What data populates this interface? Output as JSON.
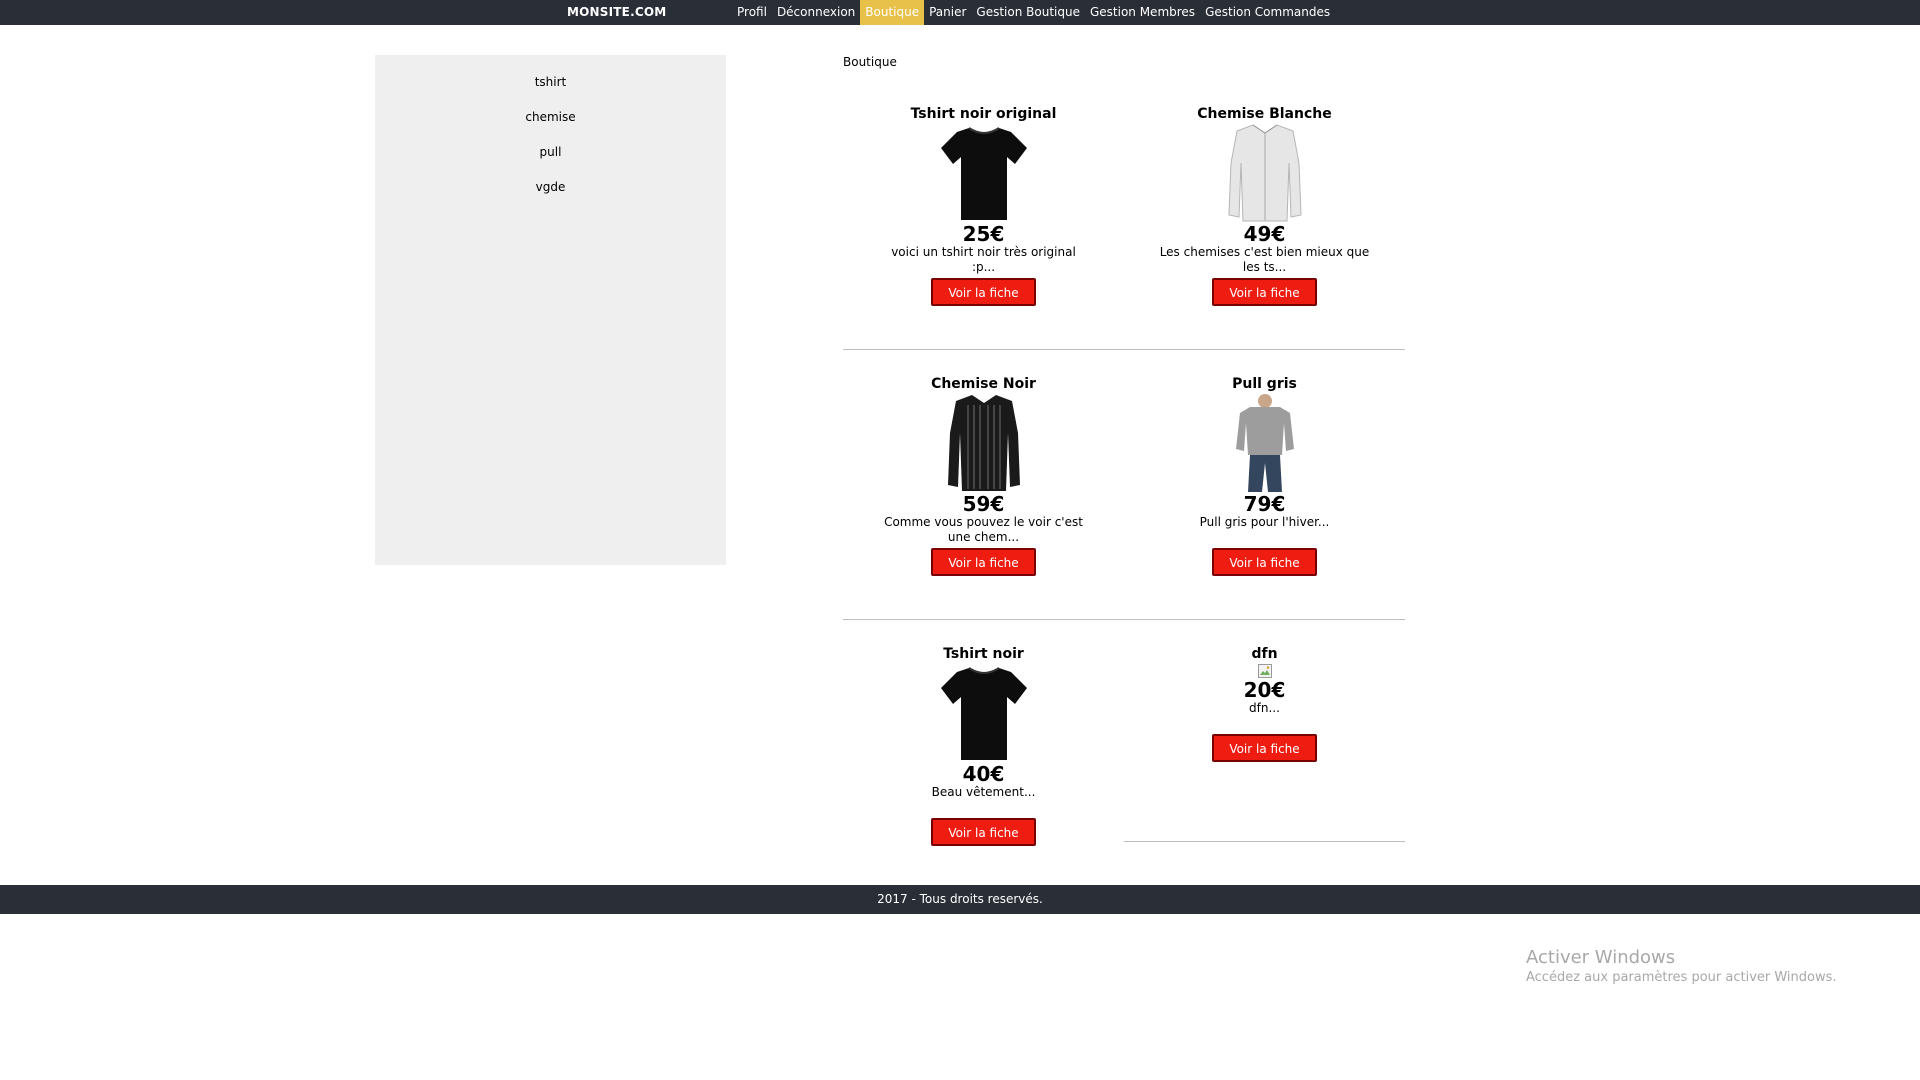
{
  "header": {
    "brand": "MONSITE.COM",
    "nav": [
      {
        "label": "Profil"
      },
      {
        "label": "Déconnexion"
      },
      {
        "label": "Boutique"
      },
      {
        "label": "Panier"
      },
      {
        "label": "Gestion Boutique"
      },
      {
        "label": "Gestion Membres"
      },
      {
        "label": "Gestion Commandes"
      }
    ],
    "active_item": "Boutique",
    "active_color": "#e8c14a"
  },
  "sidebar": {
    "categories": [
      {
        "label": "tshirt"
      },
      {
        "label": "chemise"
      },
      {
        "label": "pull"
      },
      {
        "label": "vgde"
      }
    ]
  },
  "main": {
    "page_label": "Boutique",
    "products": [
      {
        "title": "Tshirt noir original",
        "price": "25€",
        "description": "voici un tshirt noir très original :p...",
        "button": "Voir la fiche",
        "image": "black-tshirt"
      },
      {
        "title": "Chemise Blanche",
        "price": "49€",
        "description": "Les chemises c'est bien mieux que les ts...",
        "button": "Voir la fiche",
        "image": "white-shirt"
      },
      {
        "title": "Chemise Noir",
        "price": "59€",
        "description": "Comme vous pouvez le voir c'est une chem...",
        "button": "Voir la fiche",
        "image": "black-striped-shirt"
      },
      {
        "title": "Pull gris",
        "price": "79€",
        "description": "Pull gris pour l'hiver...",
        "button": "Voir la fiche",
        "image": "grey-sweater"
      },
      {
        "title": "Tshirt noir",
        "price": "40€",
        "description": "Beau vêtement...",
        "button": "Voir la fiche",
        "image": "black-tshirt"
      },
      {
        "title": "dfn",
        "price": "20€",
        "description": "dfn...",
        "button": "Voir la fiche",
        "image": "broken-image"
      }
    ],
    "button_color": "#ee1c11"
  },
  "footer": {
    "text": "2017 - Tous droits reservés."
  },
  "watermark": {
    "title": "Activer Windows",
    "subtitle": "Accédez aux paramètres pour activer Windows."
  }
}
